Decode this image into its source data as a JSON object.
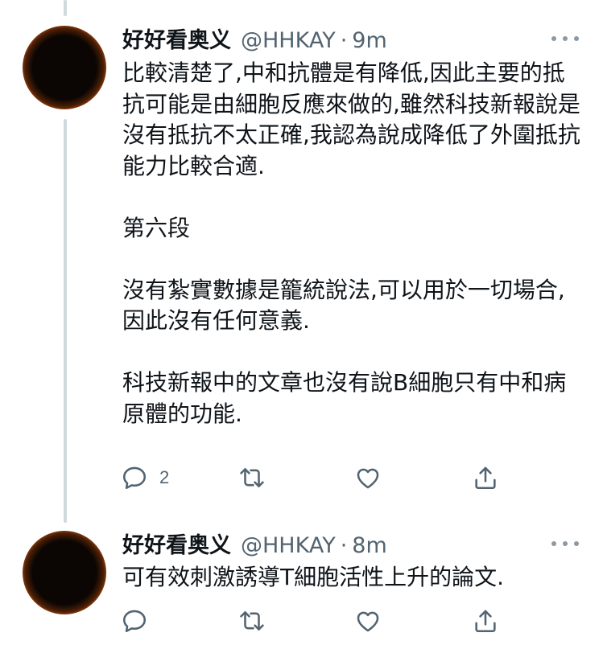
{
  "tweets": [
    {
      "author": {
        "name": "好好看奥义",
        "handle": "@HHKAY",
        "separator": "·",
        "time": "9m"
      },
      "paragraphs": [
        "比較清楚了,中和抗體是有降低,因此主要的抵抗可能是由細胞反應來做的,雖然科技新報說是沒有抵抗不太正確,我認為說成降低了外圍抵抗能力比較合適.",
        "第六段",
        "沒有紮實數據是籠統說法,可以用於一切場合,因此沒有任何意義.",
        "科技新報中的文章也沒有說B細胞只有中和病原體的功能."
      ],
      "actions": {
        "reply_count": "2",
        "reply_icon": "reply-icon",
        "retweet_icon": "retweet-icon",
        "like_icon": "heart-icon",
        "share_icon": "share-icon"
      }
    },
    {
      "author": {
        "name": "好好看奥义",
        "handle": "@HHKAY",
        "separator": "·",
        "time": "8m"
      },
      "paragraphs": [
        "可有效刺激誘導T細胞活性上升的論文."
      ],
      "actions": {
        "reply_count": "",
        "reply_icon": "reply-icon",
        "retweet_icon": "retweet-icon",
        "like_icon": "heart-icon",
        "share_icon": "share-icon"
      }
    }
  ],
  "colors": {
    "text": "#0f1419",
    "secondary": "#536471",
    "thread_line": "#cfd9de",
    "background": "#ffffff"
  }
}
